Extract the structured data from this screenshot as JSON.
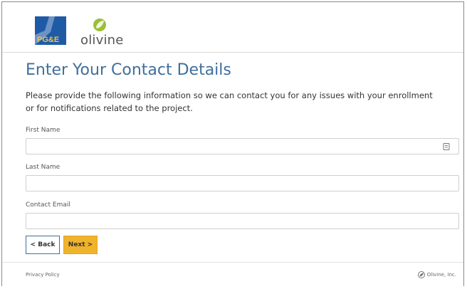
{
  "header": {
    "pge_logo_text": "PG&E",
    "olivine_logo_text": "olivine"
  },
  "form": {
    "title": "Enter Your Contact Details",
    "description": "Please provide the following information so we can contact you for any issues with your enrollment or for notifications related to the project.",
    "fields": [
      {
        "label": "First Name",
        "value": "",
        "placeholder": ""
      },
      {
        "label": "Last Name",
        "value": "",
        "placeholder": ""
      },
      {
        "label": "Contact Email",
        "value": "",
        "placeholder": ""
      }
    ],
    "back_label": "< Back",
    "next_label": "Next >"
  },
  "footer": {
    "privacy_policy": "Privacy Policy",
    "company": "Olivine, Inc."
  },
  "icons": {
    "field_icon": "contact-card-icon",
    "brand_icon": "olivine-leaf-icon"
  },
  "colors": {
    "title_blue": "#3f6f9c",
    "next_button": "#f0b32c",
    "pge_blue": "#1f5aa6"
  }
}
